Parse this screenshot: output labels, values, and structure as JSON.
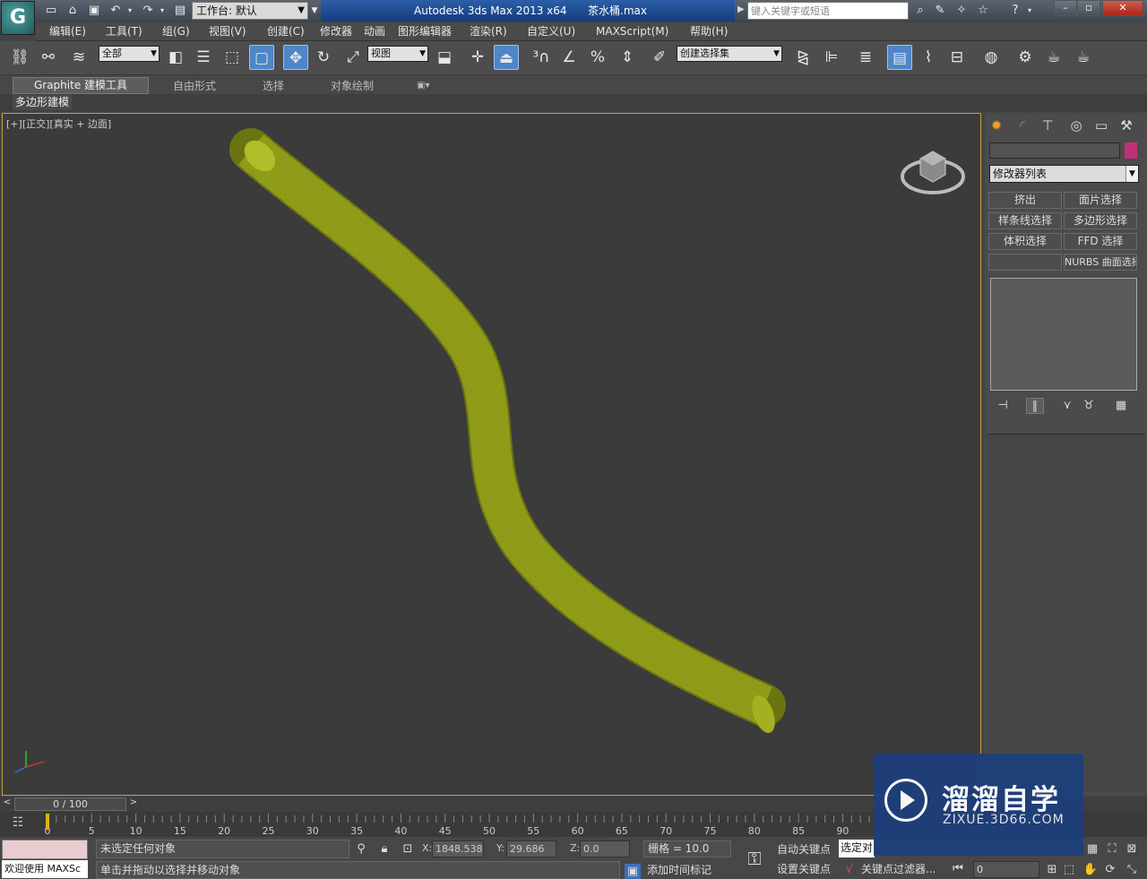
{
  "app": {
    "logo_letter": "G",
    "title": "Autodesk 3ds Max  2013 x64",
    "file_name": "茶水桶.max",
    "workspace": "工作台: 默认",
    "search_placeholder": "键入关键字或短语"
  },
  "menu": [
    "编辑(E)",
    "工具(T)",
    "组(G)",
    "视图(V)",
    "创建(C)",
    "修改器",
    "动画",
    "图形编辑器",
    "渲染(R)",
    "自定义(U)",
    "MAXScript(M)",
    "帮助(H)"
  ],
  "toolbar": {
    "selection_filter": "全部",
    "ref_coord": "视图",
    "named_selection": "创建选择集"
  },
  "ribbon": {
    "tabs": [
      "Graphite 建模工具",
      "自由形式",
      "选择",
      "对象绘制"
    ],
    "subtab": "多边形建模"
  },
  "viewport": {
    "label_parts": [
      "[+]",
      "[正交]",
      "[真实 + 边面]"
    ],
    "object_color": "#9aa61a"
  },
  "command_panel": {
    "modifier_list": "修改器列表",
    "modifier_buttons": [
      "挤出",
      "面片选择",
      "样条线选择",
      "多边形选择",
      "体积选择",
      "FFD 选择",
      "",
      "NURBS 曲面选择"
    ],
    "object_color_swatch": "#c0307a"
  },
  "timeline": {
    "frame_display": "0 / 100",
    "current_frame": 0,
    "frame_start": 0,
    "frame_end": 100,
    "ruler_labels": [
      "0",
      "5",
      "10",
      "15",
      "20",
      "25",
      "30",
      "35",
      "40",
      "45",
      "50",
      "55",
      "60",
      "65",
      "70",
      "75",
      "80",
      "85",
      "90"
    ]
  },
  "status": {
    "welcome": "欢迎使用 MAXSc",
    "selection_status": "未选定任何对象",
    "prompt": "单击并拖动以选择并移动对象",
    "x_label": "X:",
    "x": "1848.538",
    "y_label": "Y:",
    "y": "29.686",
    "z_label": "Z:",
    "z": "0.0",
    "grid": "栅格 = 10.0",
    "auto_key": "自动关键点",
    "set_key": "设置关键点",
    "selected_dd": "选定对",
    "add_time_tag": "添加时间标记",
    "key_filters": "关键点过滤器...",
    "frame_field": "0"
  },
  "watermark": {
    "cn": "溜溜自学",
    "en": "ZIXUE.3D66.COM"
  }
}
